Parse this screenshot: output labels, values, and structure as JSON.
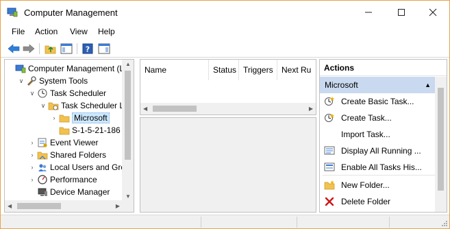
{
  "window": {
    "title": "Computer Management",
    "controls": {
      "minimize": "—",
      "maximize": "☐",
      "close": "✕"
    }
  },
  "menu": [
    "File",
    "Action",
    "View",
    "Help"
  ],
  "toolbar": {
    "buttons": [
      "back-icon",
      "forward-icon",
      "up-folder-icon",
      "show-hide-tree-icon",
      "help-icon",
      "show-hide-action-pane-icon"
    ]
  },
  "tree": {
    "items": [
      {
        "label": "Computer Management (Lo",
        "icon": "computer-management-icon",
        "arrow": "",
        "depth": 0
      },
      {
        "label": "System Tools",
        "icon": "system-tools-icon",
        "arrow": "∨",
        "depth": 1
      },
      {
        "label": "Task Scheduler",
        "icon": "clock-icon",
        "arrow": "∨",
        "depth": 2
      },
      {
        "label": "Task Scheduler L",
        "icon": "task-folder-icon",
        "arrow": "∨",
        "depth": 3
      },
      {
        "label": "Microsoft",
        "icon": "folder-icon",
        "arrow": "›",
        "depth": 4,
        "selected": true
      },
      {
        "label": "S-1-5-21-186",
        "icon": "folder-icon",
        "arrow": "",
        "depth": 4
      },
      {
        "label": "Event Viewer",
        "icon": "event-viewer-icon",
        "arrow": "›",
        "depth": 2
      },
      {
        "label": "Shared Folders",
        "icon": "shared-folders-icon",
        "arrow": "›",
        "depth": 2
      },
      {
        "label": "Local Users and Grou",
        "icon": "users-icon",
        "arrow": "›",
        "depth": 2
      },
      {
        "label": "Performance",
        "icon": "performance-icon",
        "arrow": "›",
        "depth": 2
      },
      {
        "label": "Device Manager",
        "icon": "device-manager-icon",
        "arrow": "",
        "depth": 2
      }
    ]
  },
  "task_list": {
    "columns": [
      "Name",
      "Status",
      "Triggers",
      "Next Ru"
    ]
  },
  "actions": {
    "header": "Actions",
    "group": "Microsoft",
    "items": [
      {
        "label": "Create Basic Task...",
        "icon": "create-basic-task-icon"
      },
      {
        "label": "Create Task...",
        "icon": "create-task-icon"
      },
      {
        "label": "Import Task...",
        "icon": ""
      },
      {
        "label": "Display All Running ...",
        "icon": "display-running-icon"
      },
      {
        "label": "Enable All Tasks His...",
        "icon": "enable-history-icon"
      },
      {
        "label": "New Folder...",
        "icon": "new-folder-icon"
      },
      {
        "label": "Delete Folder",
        "icon": "delete-icon"
      }
    ]
  },
  "colors": {
    "window_border": "#e8a24a",
    "selection": "#cce8ff",
    "actions_group_bg": "#c9d9ef",
    "back_arrow": "#2f7fd6",
    "delete_red": "#d21414"
  }
}
